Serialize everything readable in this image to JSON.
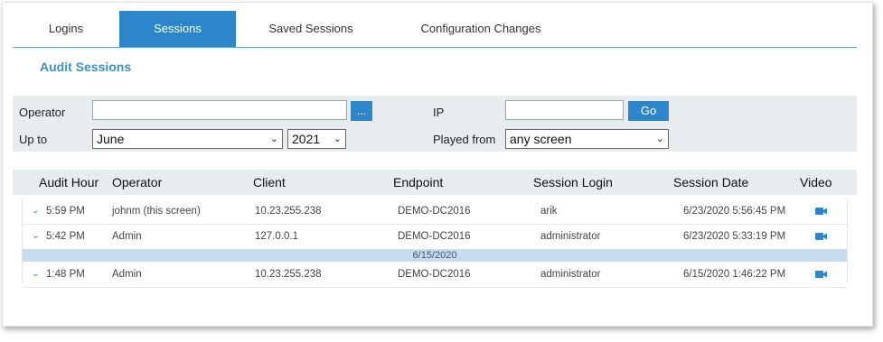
{
  "tabs": [
    {
      "label": "Logins"
    },
    {
      "label": "Sessions"
    },
    {
      "label": "Saved Sessions"
    },
    {
      "label": "Configuration Changes"
    }
  ],
  "active_tab": "Sessions",
  "section_title": "Audit Sessions",
  "filters": {
    "operator_label": "Operator",
    "operator_value": "",
    "browse_label": "...",
    "ip_label": "IP",
    "ip_value": "",
    "go_label": "Go",
    "upto_label": "Up to",
    "month_value": "June",
    "year_value": "2021",
    "played_from_label": "Played from",
    "played_from_value": "any screen"
  },
  "table": {
    "columns": [
      "Audit Hour",
      "Operator",
      "Client",
      "Endpoint",
      "Session Login",
      "Session Date",
      "Video"
    ],
    "rows": [
      {
        "hour": "5:59 PM",
        "operator": "johnm (this screen)",
        "client": "10.23.255.238",
        "endpoint": "DEMO-DC2016",
        "login": "arik",
        "date": "6/23/2020 5:56:45 PM"
      },
      {
        "hour": "5:42 PM",
        "operator": "Admin",
        "client": "127.0.0.1",
        "endpoint": "DEMO-DC2016",
        "login": "administrator",
        "date": "6/23/2020 5:33:19 PM"
      },
      {
        "hour": "1:48 PM",
        "operator": "Admin",
        "client": "10.23.255.238",
        "endpoint": "DEMO-DC2016",
        "login": "administrator",
        "date": "6/15/2020 1:46:22 PM"
      }
    ],
    "group_label": "6/15/2020"
  },
  "colors": {
    "accent": "#2d86c9",
    "group_band": "#c8dcf0"
  }
}
